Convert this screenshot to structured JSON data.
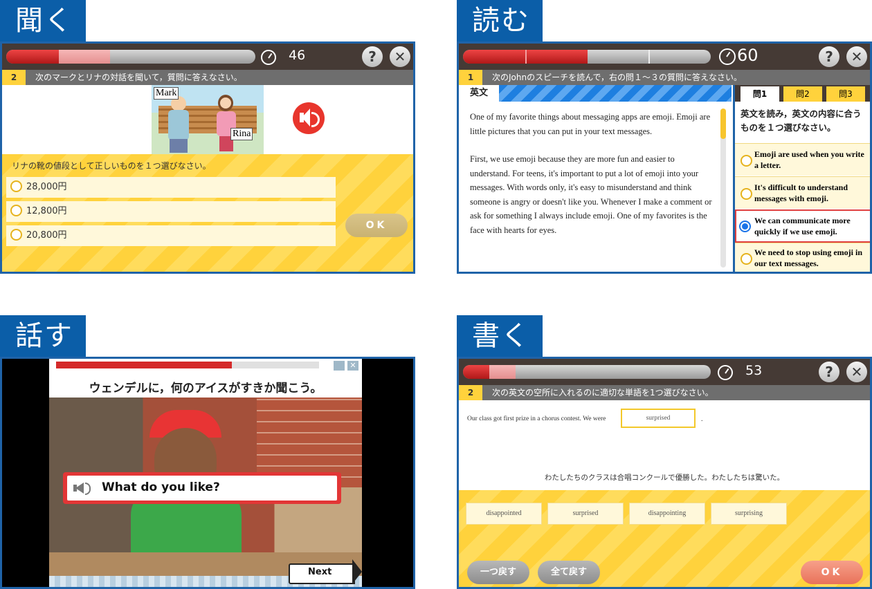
{
  "sections": {
    "listen": {
      "tag": "聞く",
      "timer": "46",
      "help": "?",
      "close": "✕",
      "q_number": "2",
      "q_instruction": "次のマークとリナの対話を聞いて，質問に答えなさい。",
      "name_left": "Mark",
      "name_right": "Rina",
      "question": "リナの靴の値段として正しいものを１つ選びなさい。",
      "options": [
        "28,000円",
        "12,800円",
        "20,800円"
      ],
      "ok": "OK"
    },
    "read": {
      "tag": "読む",
      "timer": "60",
      "help": "?",
      "close": "✕",
      "q_number": "1",
      "q_instruction": "次のJohnのスピーチを読んで，右の問１～３の質問に答えなさい。",
      "text_label": "英文",
      "paragraph1": "One of my favorite things about messaging apps are emoji. Emoji are little pictures that you can put in your text messages.",
      "paragraph2": "First, we use emoji because they are more fun and easier to understand. For teens, it's important to put a lot of emoji into your messages. With words only, it's easy to misunderstand and think someone is angry or doesn't like you. Whenever I make a comment or ask for something I always include emoji. One of my favorites is the face with hearts for eyes.",
      "tabs": [
        "問1",
        "問2",
        "問3"
      ],
      "prompt": "英文を読み，英文の内容に合うものを１つ選びなさい。",
      "options": [
        "Emoji are used when you write a letter.",
        "It's difficult to understand messages with emoji.",
        "We can communicate more quickly if we use emoji.",
        "We need to stop using emoji in our text messages."
      ],
      "selected_option": 3
    },
    "speak": {
      "tag": "話す",
      "prompt": "ウェンデルに，何のアイスがすきか聞こう。",
      "bubble": "What do you like?",
      "next": "Next"
    },
    "write": {
      "tag": "書く",
      "timer": "53",
      "help": "?",
      "close": "✕",
      "q_number": "2",
      "q_instruction": "次の英文の空所に入れるのに適切な単語を1つ選びなさい。",
      "sentence_before": "Our class got first prize in a chorus contest. We were",
      "answer": "surprised",
      "sentence_after": ".",
      "translation": "わたしたちのクラスは合唱コンクールで優勝した。わたしたちは驚いた。",
      "choices": [
        "disappointed",
        "surprised",
        "disappointing",
        "surprising"
      ],
      "back_one": "一つ戻す",
      "back_all": "全て戻す",
      "ok": "OK"
    }
  },
  "colors": {
    "tag_blue": "#0b5ea8",
    "bar_dark": "#453a35",
    "accent_yellow": "#ffd23c",
    "progress_red": "#d42a2a",
    "ok_salmon": "#f0846a",
    "selected_blue": "#1a73e8"
  }
}
